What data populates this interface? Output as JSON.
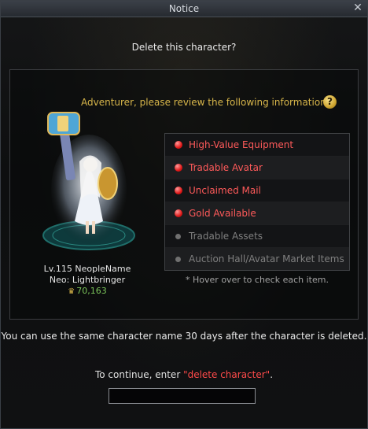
{
  "window": {
    "title": "Notice",
    "close_glyph": "✕"
  },
  "question": "Delete this character?",
  "review": {
    "text": "Adventurer, please review the following information.",
    "help_glyph": "?"
  },
  "character": {
    "level_name": "Lv.115 NeopleName",
    "job": "Neo: Lightbringer",
    "score_icon": "crown-icon",
    "score": "70,163"
  },
  "checklist": [
    {
      "label": "High-Value Equipment",
      "status": "active"
    },
    {
      "label": "Tradable Avatar",
      "status": "active"
    },
    {
      "label": "Unclaimed Mail",
      "status": "active"
    },
    {
      "label": "Gold Available",
      "status": "active"
    },
    {
      "label": "Tradable Assets",
      "status": "inactive"
    },
    {
      "label": "Auction Hall/Avatar Market Items",
      "status": "inactive"
    }
  ],
  "hint": "* Hover over to check each item.",
  "rename_notice": "You can use the same character name 30 days after the character is deleted.",
  "confirm": {
    "prefix": "To continue, enter ",
    "keyword": "\"delete character\"",
    "suffix": ".",
    "input_value": "",
    "input_placeholder": ""
  },
  "colors": {
    "active_item": "#ff5a5a",
    "inactive_item": "#7f7f7f",
    "review_text": "#d8b64a",
    "score": "#7bc45a",
    "keyword": "#ff4a4a"
  }
}
